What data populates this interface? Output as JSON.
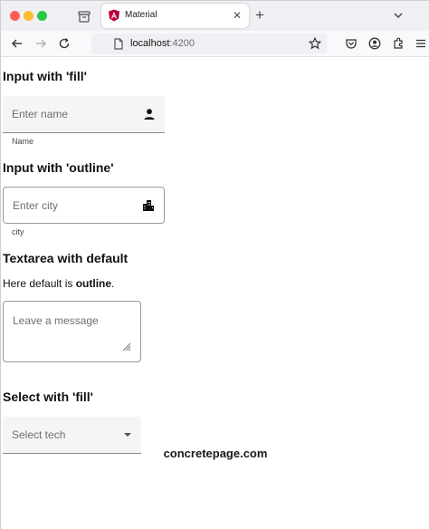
{
  "browser": {
    "tab": {
      "title": "Material",
      "close": "✕"
    },
    "new_tab": "+",
    "url": {
      "host": "localhost",
      "port": ":4200"
    },
    "icons": {
      "tab_list": "tab-list-icon",
      "favicon": "angular-favicon",
      "overflow": "chevron-down-icon",
      "back": "back-arrow-icon",
      "forward": "forward-arrow-icon",
      "reload": "reload-icon",
      "shield": "shield-icon",
      "page_info": "page-icon",
      "bookmark": "star-icon",
      "pocket": "pocket-icon",
      "account": "account-icon",
      "extensions": "extensions-icon",
      "menu": "hamburger-icon"
    }
  },
  "page": {
    "sections": {
      "fill_input": {
        "heading": "Input with 'fill'",
        "placeholder": "Enter name",
        "hint": "Name",
        "icon": "person-icon"
      },
      "outline_input": {
        "heading": "Input with 'outline'",
        "placeholder": "Enter city",
        "hint": "city",
        "icon": "city-icon"
      },
      "textarea": {
        "heading": "Textarea with default",
        "desc_prefix": "Here default is ",
        "desc_bold": "outline",
        "desc_suffix": ".",
        "placeholder": "Leave a message"
      },
      "select": {
        "heading": "Select with 'fill'",
        "placeholder": "Select tech"
      }
    },
    "watermark": "concretepage.com"
  }
}
